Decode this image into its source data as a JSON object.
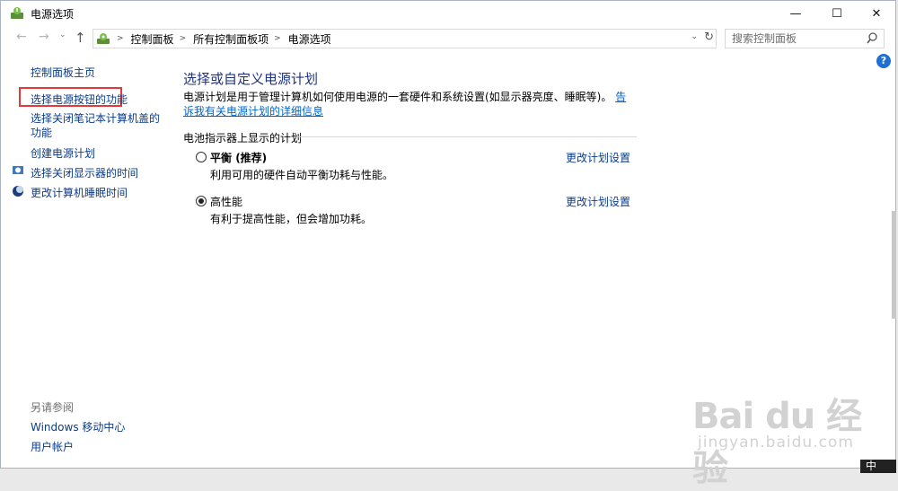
{
  "window": {
    "title": "电源选项",
    "minimize": "—",
    "maximize": "☐",
    "close": "✕"
  },
  "nav": {
    "back": "←",
    "forward": "→",
    "history": "⌄",
    "up": "↑",
    "breadcrumbs": [
      "控制面板",
      "所有控制面板项",
      "电源选项"
    ],
    "dropdown": "⌄",
    "refresh": "↻"
  },
  "search": {
    "placeholder": "搜索控制面板"
  },
  "help": "?",
  "sidebar": {
    "home": "控制面板主页",
    "items": [
      "选择电源按钮的功能",
      "选择关闭笔记本计算机盖的功能",
      "创建电源计划",
      "选择关闭显示器的时间",
      "更改计算机睡眠时间"
    ],
    "see_also_title": "另请参阅",
    "see_also": [
      "Windows 移动中心",
      "用户帐户"
    ]
  },
  "main": {
    "title": "选择或自定义电源计划",
    "description": "电源计划是用于管理计算机如何使用电源的一套硬件和系统设置(如显示器亮度、睡眠等)。",
    "description_link": "告诉我有关电源计划的详细信息",
    "group_heading": "电池指示器上显示的计划",
    "plans": [
      {
        "name": "平衡",
        "tag": " (推荐)",
        "desc": "利用可用的硬件自动平衡功耗与性能。",
        "link": "更改计划设置",
        "selected": false
      },
      {
        "name": "高性能",
        "tag": "",
        "desc": "有利于提高性能，但会增加功耗。",
        "link": "更改计划设置",
        "selected": true
      }
    ]
  },
  "taskbar": {
    "ime": "中"
  },
  "watermark": {
    "logo": "Bai du 经验",
    "url": "jingyan.baidu.com"
  },
  "colors": {
    "link": "#0a3c8c",
    "title": "#1e3287",
    "highlight": "#e53838",
    "help": "#1f6fd0"
  }
}
